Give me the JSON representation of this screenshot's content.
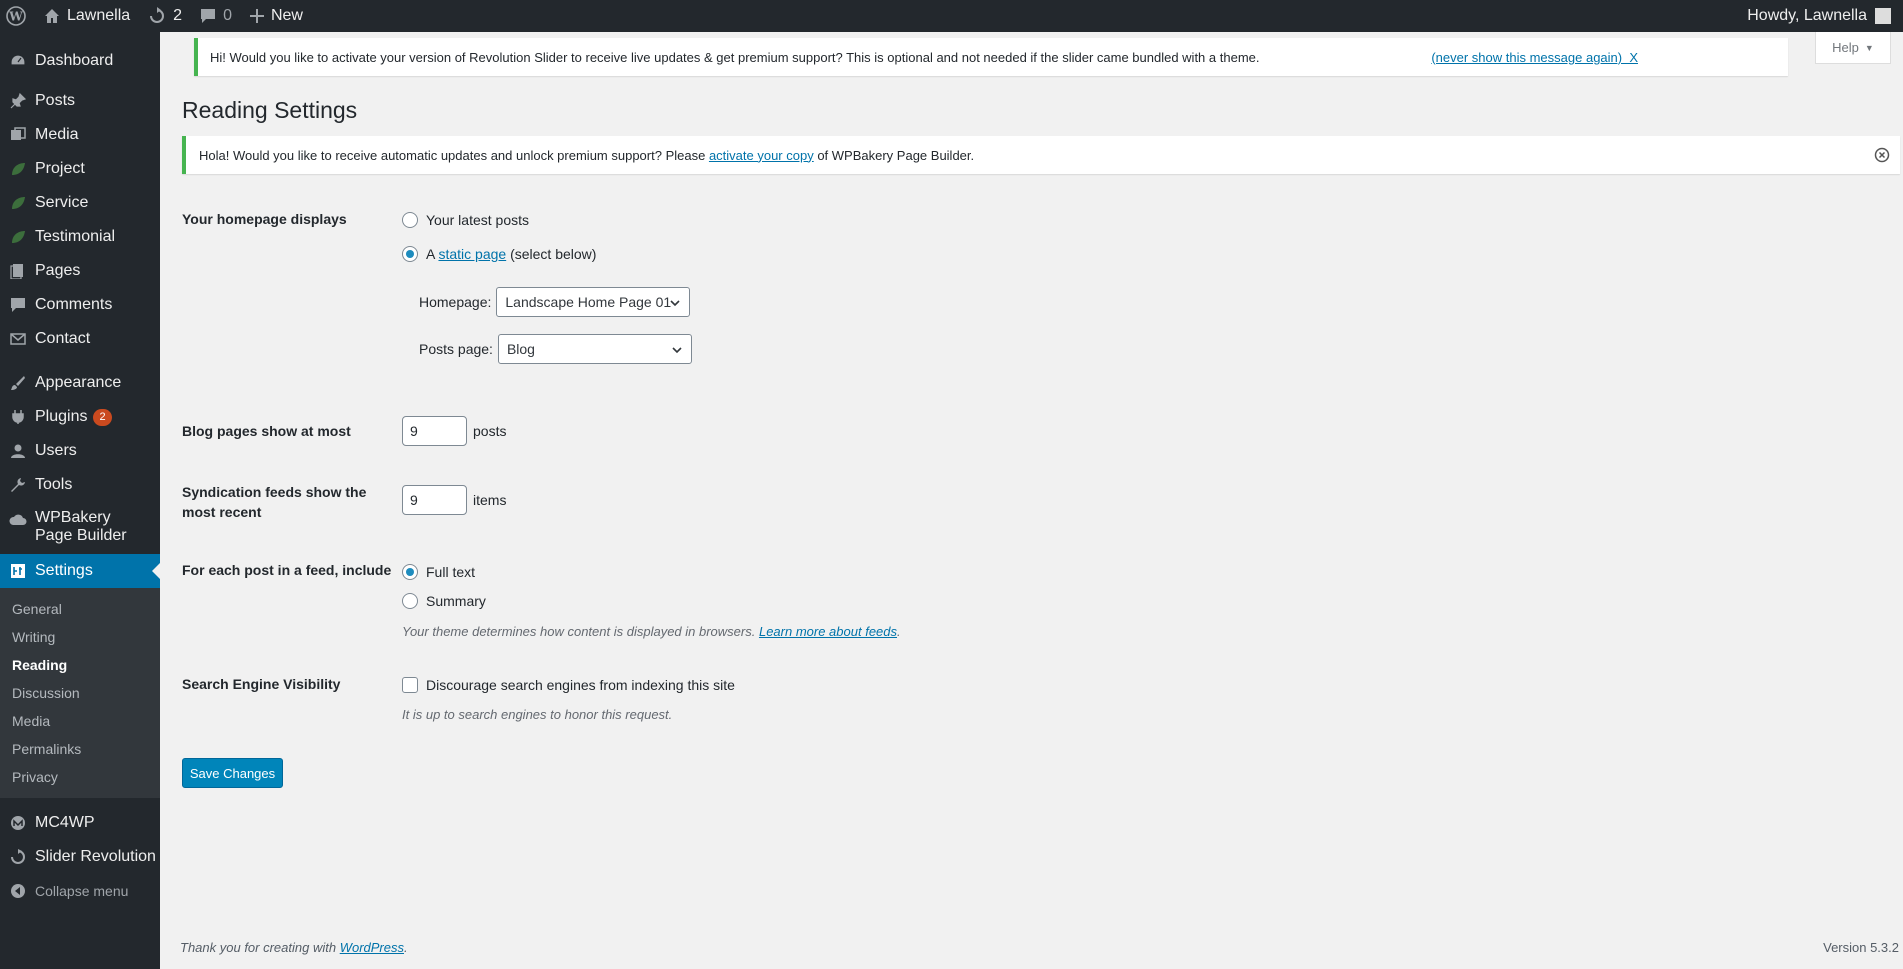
{
  "adminbar": {
    "site_name": "Lawnella",
    "updates_count": "2",
    "comments_count": "0",
    "new_label": "New",
    "greeting": "Howdy, Lawnella"
  },
  "sidebar": {
    "items": [
      {
        "label": "Dashboard",
        "icon": "dashboard-icon"
      },
      {
        "label": "Posts",
        "icon": "pin-icon"
      },
      {
        "label": "Media",
        "icon": "media-icon"
      },
      {
        "label": "Project",
        "icon": "leaf-icon"
      },
      {
        "label": "Service",
        "icon": "leaf-icon"
      },
      {
        "label": "Testimonial",
        "icon": "leaf-icon"
      },
      {
        "label": "Pages",
        "icon": "pages-icon"
      },
      {
        "label": "Comments",
        "icon": "comment-icon"
      },
      {
        "label": "Contact",
        "icon": "mail-icon"
      },
      {
        "label": "Appearance",
        "icon": "brush-icon"
      },
      {
        "label": "Plugins",
        "icon": "plugin-icon",
        "badge": "2"
      },
      {
        "label": "Users",
        "icon": "user-icon"
      },
      {
        "label": "Tools",
        "icon": "wrench-icon"
      },
      {
        "label": "WPBakery Page Builder",
        "icon": "cloud-icon"
      },
      {
        "label": "Settings",
        "icon": "settings-icon"
      }
    ],
    "submenu": [
      "General",
      "Writing",
      "Reading",
      "Discussion",
      "Media",
      "Permalinks",
      "Privacy"
    ],
    "after": [
      {
        "label": "MC4WP",
        "icon": "mc4wp-icon"
      },
      {
        "label": "Slider Revolution",
        "icon": "refresh-icon"
      },
      {
        "label": "Collapse menu",
        "icon": "collapse-icon"
      }
    ]
  },
  "notices": {
    "revslider": "Hi! Would you like to activate your version of Revolution Slider to receive live updates & get premium support? This is optional and not needed if the slider came bundled with a theme.",
    "revslider_dismiss": "(never show this message again)  X",
    "wpb_before": "Hola! Would you like to receive automatic updates and unlock premium support? Please ",
    "wpb_link": "activate your copy",
    "wpb_after": " of WPBakery Page Builder."
  },
  "help_tab": "Help",
  "page_title": "Reading Settings",
  "form": {
    "homepage_displays_label": "Your homepage displays",
    "latest_posts_label": "Your latest posts",
    "static_a": "A ",
    "static_link": "static page",
    "static_after": " (select below)",
    "homepage_label": "Homepage:",
    "homepage_value": "Landscape Home Page 01",
    "posts_page_label": "Posts page:",
    "posts_page_value": "Blog",
    "blog_pages_label": "Blog pages show at most",
    "blog_pages_value": "9",
    "blog_pages_unit": "posts",
    "feeds_label_1": "Syndication feeds show the",
    "feeds_label_2": "most recent",
    "feeds_value": "9",
    "feeds_unit": "items",
    "feed_include_label": "For each post in a feed, include",
    "full_text_label": "Full text",
    "summary_label": "Summary",
    "theme_desc": "Your theme determines how content is displayed in browsers. ",
    "learn_more": "Learn more about feeds",
    "theme_desc_end": ".",
    "sev_label": "Search Engine Visibility",
    "discourage_label": "Discourage search engines from indexing this site",
    "sev_desc": "It is up to search engines to honor this request.",
    "save_label": "Save Changes"
  },
  "footer": {
    "thanks": "Thank you for creating with ",
    "wp_link": "WordPress",
    "thanks_end": ".",
    "version": "Version 5.3.2"
  },
  "colors": {
    "adminbar_bg": "#23282d",
    "active_menu": "#0073aa",
    "notice_border": "#46b450",
    "primary_button": "#0085ba",
    "badge": "#ca4a1f"
  }
}
